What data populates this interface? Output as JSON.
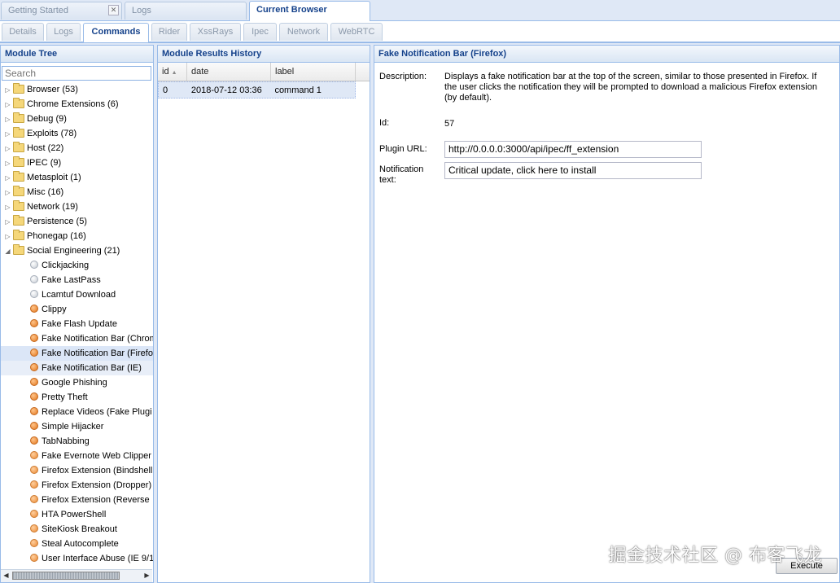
{
  "top_tabs": [
    {
      "label": "Getting Started",
      "closable": true
    },
    {
      "label": "Logs",
      "closable": false
    },
    {
      "label": "Current Browser",
      "closable": false,
      "active": true
    }
  ],
  "sub_tabs": [
    "Details",
    "Logs",
    "Commands",
    "Rider",
    "XssRays",
    "Ipec",
    "Network",
    "WebRTC"
  ],
  "active_sub_tab": "Commands",
  "module_tree": {
    "title": "Module Tree",
    "search_placeholder": "Search",
    "categories": [
      "Browser (53)",
      "Chrome Extensions (6)",
      "Debug (9)",
      "Exploits (78)",
      "Host (22)",
      "IPEC (9)",
      "Metasploit (1)",
      "Misc (16)",
      "Network (19)",
      "Persistence (5)",
      "Phonegap (16)"
    ],
    "expanded_category": "Social Engineering (21)",
    "modules": [
      {
        "label": "Clickjacking",
        "status": "grey"
      },
      {
        "label": "Fake LastPass",
        "status": "grey"
      },
      {
        "label": "Lcamtuf Download",
        "status": "grey"
      },
      {
        "label": "Clippy",
        "status": "orange"
      },
      {
        "label": "Fake Flash Update",
        "status": "orange"
      },
      {
        "label": "Fake Notification Bar (Chrom",
        "status": "orange"
      },
      {
        "label": "Fake Notification Bar (Firefo",
        "status": "orange"
      },
      {
        "label": "Fake Notification Bar (IE)",
        "status": "orange"
      },
      {
        "label": "Google Phishing",
        "status": "orange"
      },
      {
        "label": "Pretty Theft",
        "status": "orange"
      },
      {
        "label": "Replace Videos (Fake Plugi",
        "status": "orange"
      },
      {
        "label": "Simple Hijacker",
        "status": "orange"
      },
      {
        "label": "TabNabbing",
        "status": "orange"
      },
      {
        "label": "Fake Evernote Web Clipper",
        "status": "orange-s"
      },
      {
        "label": "Firefox Extension (Bindshell",
        "status": "orange-s"
      },
      {
        "label": "Firefox Extension (Dropper)",
        "status": "orange-s"
      },
      {
        "label": "Firefox Extension (Reverse",
        "status": "orange-s"
      },
      {
        "label": "HTA PowerShell",
        "status": "orange-s"
      },
      {
        "label": "SiteKiosk Breakout",
        "status": "orange-s"
      },
      {
        "label": "Steal Autocomplete",
        "status": "orange-s"
      },
      {
        "label": "User Interface Abuse (IE 9/1",
        "status": "orange-s"
      }
    ],
    "selected_module": "Fake Notification Bar (Firefo",
    "hovered_module": "Fake Notification Bar (IE)"
  },
  "results": {
    "title": "Module Results History",
    "columns": [
      "id",
      "date",
      "label"
    ],
    "rows": [
      {
        "id": "0",
        "date": "2018-07-12 03:36",
        "label": "command 1"
      }
    ]
  },
  "detail": {
    "title": "Fake Notification Bar (Firefox)",
    "description_label": "Description:",
    "description": "Displays a fake notification bar at the top of the screen, similar to those presented in Firefox. If the user clicks the notification they will be prompted to download a malicious Firefox extension (by default).",
    "id_label": "Id:",
    "id_value": "57",
    "plugin_url_label": "Plugin URL:",
    "plugin_url": "http://0.0.0.0:3000/api/ipec/ff_extension",
    "notification_label": "Notification text:",
    "notification_text": "Critical update, click here to install",
    "execute_label": "Execute"
  },
  "watermark": "掘金技术社区 @ 布客飞龙",
  "colors": {
    "header_text": "#15428b",
    "border": "#99bbe8",
    "selected_row": "#dbe6f7",
    "module_orange": "#e2781f"
  }
}
